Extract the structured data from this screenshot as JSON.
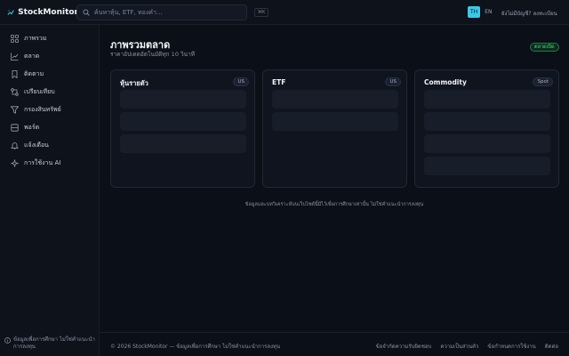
{
  "header": {
    "app_name": "StockMonitor",
    "search_placeholder": "ค้นหาหุ้น, ETF, ทองคำ…",
    "shortcut": "⌘K",
    "lang_th": "TH",
    "lang_en": "EN",
    "login_link": "ยังไม่มีบัญชี? ลงทะเบียน"
  },
  "sidebar": {
    "items": [
      {
        "label": "ภาพรวม",
        "icon": "grid-icon"
      },
      {
        "label": "ตลาด",
        "icon": "chart-line-icon"
      },
      {
        "label": "ติดตาม",
        "icon": "bookmark-icon"
      },
      {
        "label": "เปรียบเทียบ",
        "icon": "compare-icon"
      },
      {
        "label": "กรองสินทรัพย์",
        "icon": "filter-icon"
      },
      {
        "label": "พอร์ต",
        "icon": "portfolio-icon"
      },
      {
        "label": "แจ้งเตือน",
        "icon": "bell-icon"
      },
      {
        "label": "การใช้งาน AI",
        "icon": "sparkle-icon"
      }
    ],
    "footer_note": "ข้อมูลเพื่อการศึกษา ไม่ใช่คำแนะนำการลงทุน"
  },
  "main": {
    "title": "ภาพรวมตลาด",
    "subtitle": "ราคาอัปเดตอัตโนมัติทุก 10 วินาที",
    "status_badge": "ตลาดเปิด",
    "cards": [
      {
        "title": "หุ้นรายตัว",
        "tag": "US"
      },
      {
        "title": "ETF",
        "tag": "US"
      },
      {
        "title": "Commodity",
        "tag": "Spot"
      }
    ],
    "disclaimer": "ข้อมูลและบทวิเคราะห์บนเว็บไซต์นี้มีไว้เพื่อการศึกษาเท่านั้น ไม่ใช่คำแนะนำการลงทุน"
  },
  "footer": {
    "copyright": "© 2026 StockMonitor — ข้อมูลเพื่อการศึกษา ไม่ใช่คำแนะนำการลงทุน",
    "links": [
      "ข้อจำกัดความรับผิดชอบ",
      "ความเป็นส่วนตัว",
      "ข้อกำหนดการใช้งาน",
      "ติดต่อ"
    ]
  },
  "colors": {
    "accent": "#3bc9e8",
    "success": "#4ade80",
    "background": "#0b0f17"
  }
}
